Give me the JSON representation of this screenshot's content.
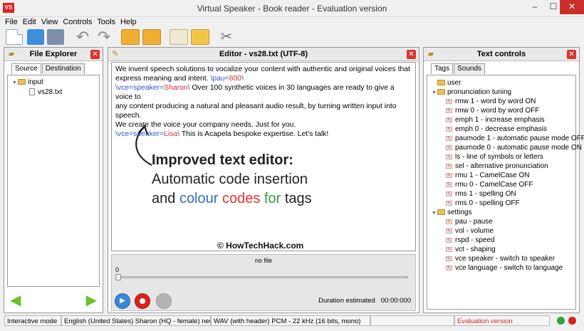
{
  "window": {
    "app_icon": "VS",
    "title": "Virtual Speaker - Book reader - Evaluation version",
    "min_glyph": "–",
    "max_glyph": "☐",
    "close_glyph": "✕"
  },
  "menu": [
    "File",
    "Edit",
    "View",
    "Controls",
    "Tools",
    "Help"
  ],
  "toolbar": {
    "icons": [
      "new-document-icon",
      "open-folder-icon",
      "save-icon",
      "undo-icon",
      "redo-icon",
      "open-book-icon",
      "folder-open-icon",
      "edit-note-icon",
      "audio-folder-icon",
      "tools-icon"
    ],
    "undo_glyph": "↶",
    "redo_glyph": "↷",
    "tools_glyph": "✂"
  },
  "file_explorer": {
    "title": "File Explorer",
    "tabs": [
      "Source",
      "Destination"
    ],
    "tree": [
      {
        "label": "input",
        "type": "folder",
        "expanded": true
      },
      {
        "label": "vs28.txt",
        "type": "file"
      }
    ]
  },
  "editor": {
    "title": "Editor - vs28.txt  (UTF-8)",
    "lines": [
      [
        {
          "t": "We invent speech solutions to vocalize your content with authentic and original voices that",
          "c": "text"
        }
      ],
      [
        {
          "t": "express meaning and intent. ",
          "c": "text"
        },
        {
          "t": "\\pau=",
          "c": "code"
        },
        {
          "t": "800",
          "c": "value"
        },
        {
          "t": "\\",
          "c": "code"
        }
      ],
      [
        {
          "t": "\\vce=speaker=",
          "c": "code"
        },
        {
          "t": "Sharon",
          "c": "value"
        },
        {
          "t": "\\",
          "c": "code"
        },
        {
          "t": " Over 100 synthetic voices in 30 languages are ready to give a voice to",
          "c": "text"
        }
      ],
      [
        {
          "t": "any content producing a natural and pleasant audio result, by turning written input into speech.",
          "c": "text"
        }
      ],
      [
        {
          "t": "We create the voice your company needs. Just for you.",
          "c": "text"
        }
      ],
      [
        {
          "t": "\\vce=speaker=",
          "c": "code"
        },
        {
          "t": "Lisa",
          "c": "value"
        },
        {
          "t": "\\",
          "c": "code"
        },
        {
          "t": " This is Acapela bespoke expertise. Let's talk!",
          "c": "text"
        }
      ]
    ],
    "annotation": {
      "line1": "Improved text editor:",
      "line2": "Automatic code insertion",
      "line3": {
        "pre": "and ",
        "w1": "colour",
        "w2": "codes",
        "w3": "for",
        "post": " tags"
      }
    },
    "watermark": "© HowTechHack.com"
  },
  "player": {
    "file_label": "no file",
    "position": "0",
    "duration_label": "Duration estimated",
    "duration_value": "00:00:000",
    "play_glyph": "▶"
  },
  "text_controls": {
    "title": "Text controls",
    "tabs": [
      "Tags",
      "Sounds"
    ],
    "tree": [
      {
        "label": "user",
        "type": "folder",
        "level": 0,
        "expanded": false
      },
      {
        "label": "pronunciation tuning",
        "type": "folder",
        "level": 0,
        "expanded": true
      },
      {
        "label": "rmw 1 - word by word ON",
        "type": "tag",
        "level": 1
      },
      {
        "label": "rmw 0 - word by word OFF",
        "type": "tag",
        "level": 1
      },
      {
        "label": "emph 1 - increase emphasis",
        "type": "tag",
        "level": 1
      },
      {
        "label": "emph 0 - decrease emphasis",
        "type": "tag",
        "level": 1
      },
      {
        "label": "paumode 1 - automatic pause mode OFF",
        "type": "tag",
        "level": 1
      },
      {
        "label": "paumode 0 - automatic pause mode ON",
        "type": "tag",
        "level": 1
      },
      {
        "label": "ls - line of symbols or letters",
        "type": "tag",
        "level": 1
      },
      {
        "label": "sel - alternative pronunciation",
        "type": "tag",
        "level": 1
      },
      {
        "label": "rmu 1 - CamelCase ON",
        "type": "tag",
        "level": 1
      },
      {
        "label": "rmu 0 - CamelCase OFF",
        "type": "tag",
        "level": 1
      },
      {
        "label": "rms 1 - spelling ON",
        "type": "tag",
        "level": 1
      },
      {
        "label": "rms 0 - spelling OFF",
        "type": "tag",
        "level": 1
      },
      {
        "label": "settings",
        "type": "folder",
        "level": 0,
        "expanded": true
      },
      {
        "label": "pau - pause",
        "type": "tag",
        "level": 1
      },
      {
        "label": "vol - volume",
        "type": "tag",
        "level": 1
      },
      {
        "label": "rspd - speed",
        "type": "tag",
        "level": 1
      },
      {
        "label": "vct - shaping",
        "type": "tag",
        "level": 1
      },
      {
        "label": "vce speaker - switch to speaker",
        "type": "tag",
        "level": 1
      },
      {
        "label": "vce language - switch to language",
        "type": "tag",
        "level": 1
      }
    ]
  },
  "statusbar": {
    "mode": "Interactive mode",
    "voice": "English (United States) Sharon  (HQ - female) neutral",
    "format": "WAV (with header)  PCM - 22 kHz  (16 bits, mono)",
    "evaluation": "Evaluation version"
  },
  "colors": {
    "code": "#2a58c8",
    "value": "#d12f2f",
    "close": "#d9342b",
    "evaluation": "#d02626",
    "status_green": "#2fa43a",
    "status_red": "#d9221e"
  }
}
